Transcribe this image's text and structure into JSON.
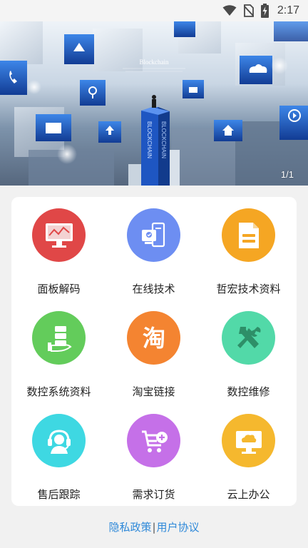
{
  "status_bar": {
    "time": "2:17",
    "icons": [
      "wifi-icon",
      "no-sim-icon",
      "battery-charging-icon"
    ]
  },
  "banner": {
    "caption": "Blockchain",
    "tower_text_1": "BLOCKCHAIN",
    "tower_text_2": "BLOCKCHAIN",
    "counter": "1/1"
  },
  "grid": {
    "items": [
      {
        "label": "面板解码",
        "color": "#e04747",
        "icon": "monitor-chart-icon"
      },
      {
        "label": "在线技术",
        "color": "#6d8ef2",
        "icon": "document-checklist-icon"
      },
      {
        "label": "哲宏技术资料",
        "color": "#f5a623",
        "icon": "document-icon"
      },
      {
        "label": "数控系统资料",
        "color": "#63cc5b",
        "icon": "hand-stack-icon"
      },
      {
        "label": "淘宝链接",
        "color": "#f48431",
        "icon": "taobao-icon"
      },
      {
        "label": "数控维修",
        "color": "#52d9a8",
        "icon": "tools-icon"
      },
      {
        "label": "售后跟踪",
        "color": "#3ed8e2",
        "icon": "headset-agent-icon"
      },
      {
        "label": "需求订货",
        "color": "#c570e8",
        "icon": "cart-add-icon"
      },
      {
        "label": "云上办公",
        "color": "#f5b82e",
        "icon": "cloud-monitor-icon"
      }
    ]
  },
  "footer": {
    "privacy": "隐私政策",
    "separator": "|",
    "agreement": "用户协议"
  }
}
